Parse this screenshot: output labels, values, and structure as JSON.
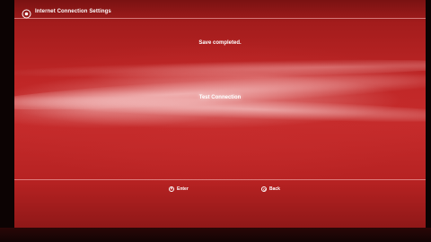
{
  "window": {
    "title": "Internet Connection Settings",
    "icon": "playstation-logo-icon"
  },
  "dialog": {
    "message": "Save completed.",
    "action_label": "Test Connection"
  },
  "footer": {
    "enter_icon": "cross-button-icon",
    "enter_label": "Enter",
    "back_icon": "circle-button-icon",
    "back_label": "Back"
  },
  "colors": {
    "background_red": "#c52b2b",
    "text": "#ffffff"
  }
}
